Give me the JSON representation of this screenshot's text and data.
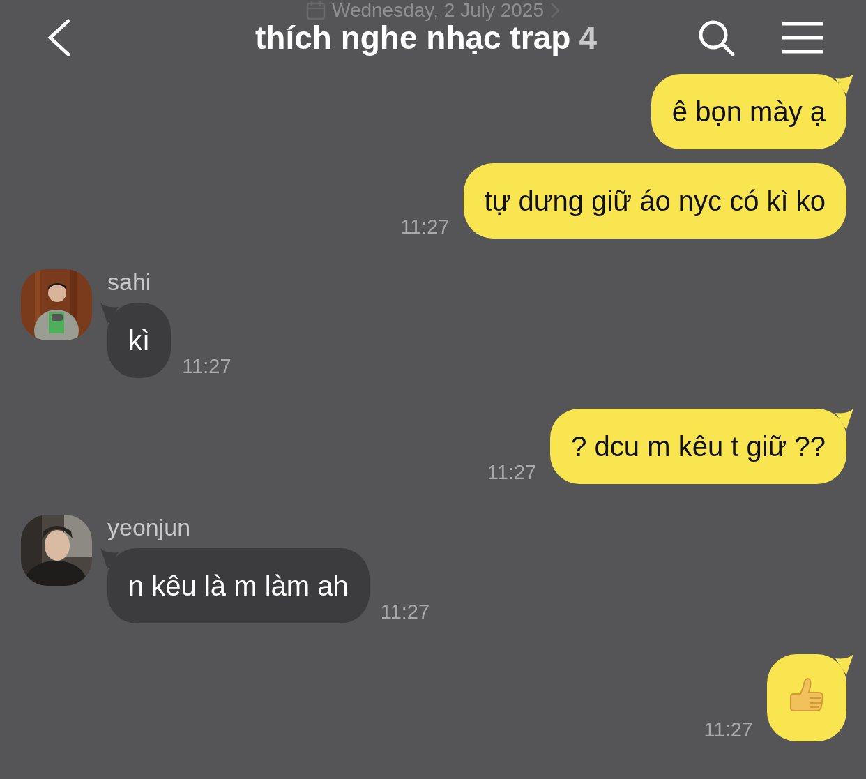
{
  "date_banner": {
    "text": "Wednesday, 2 July 2025"
  },
  "header": {
    "title": "thích nghe nhạc trap",
    "member_count": "4"
  },
  "messages": [
    {
      "kind": "text",
      "outgoing": true,
      "text": "ê bọn mày ạ"
    },
    {
      "kind": "text",
      "outgoing": true,
      "text": "tự dưng giữ áo nyc có kì ko",
      "time": "11:27"
    },
    {
      "kind": "text",
      "outgoing": false,
      "sender": "sahi",
      "text": "kì",
      "time": "11:27"
    },
    {
      "kind": "text",
      "outgoing": true,
      "text": "? dcu m kêu t giữ ??",
      "time": "11:27"
    },
    {
      "kind": "text",
      "outgoing": false,
      "sender": "yeonjun",
      "text": "n kêu là m làm ah",
      "time": "11:27"
    },
    {
      "kind": "thumbs_up",
      "outgoing": true,
      "time": "11:27"
    }
  ]
}
